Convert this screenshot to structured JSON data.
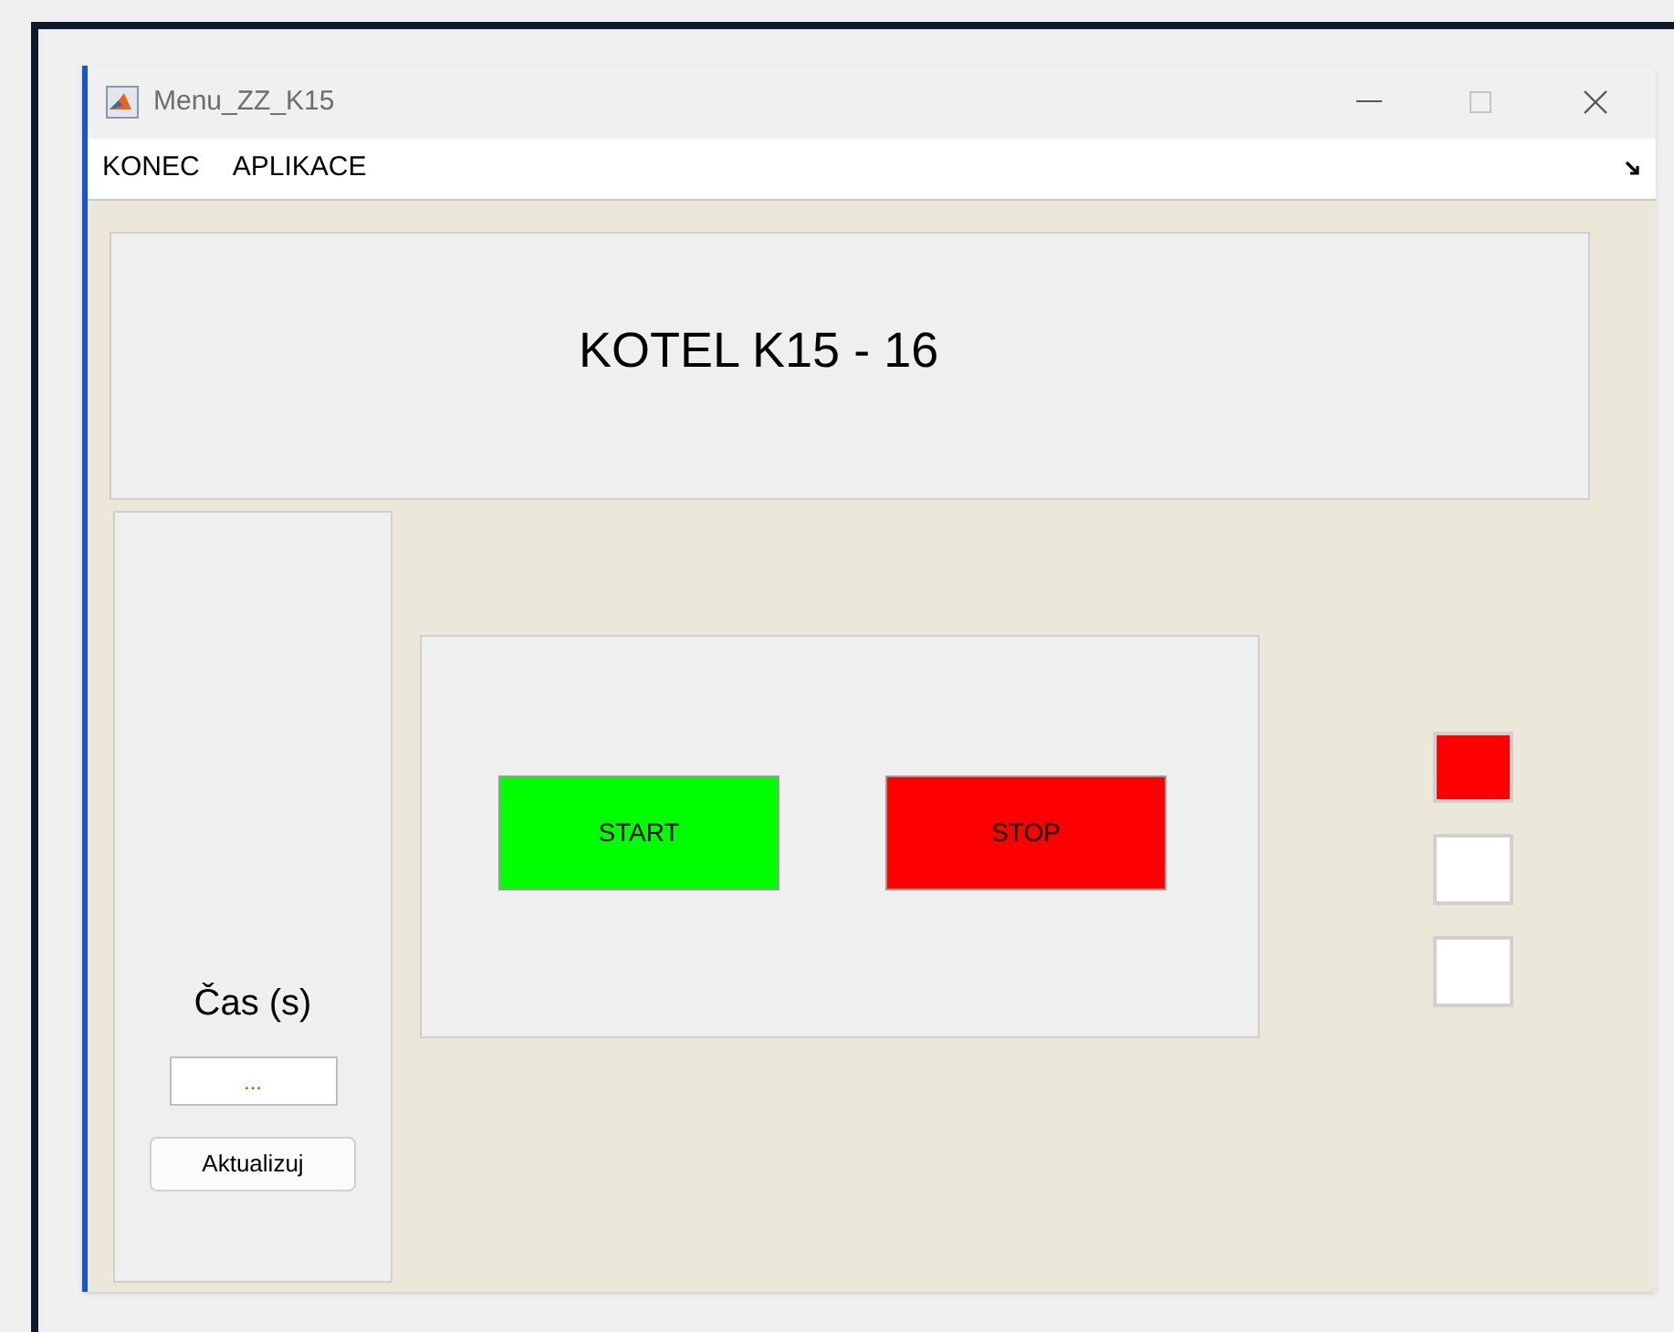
{
  "window": {
    "title": "Menu_ZZ_K15"
  },
  "menu": [
    {
      "label": "KONEC"
    },
    {
      "label": "APLIKACE"
    }
  ],
  "header": {
    "title": "KOTEL K15 - 16"
  },
  "time_panel": {
    "label": "Čas (s)",
    "field": {
      "placeholder": "..."
    },
    "button": "Aktualizuj"
  },
  "controls": [
    {
      "label": "START",
      "color": "#00ff00"
    },
    {
      "label": "STOP",
      "color": "#ff0000"
    }
  ],
  "indicators": [
    {
      "color": "#ff0000"
    },
    {
      "color": "#ffffff"
    },
    {
      "color": "#ffffff"
    }
  ]
}
